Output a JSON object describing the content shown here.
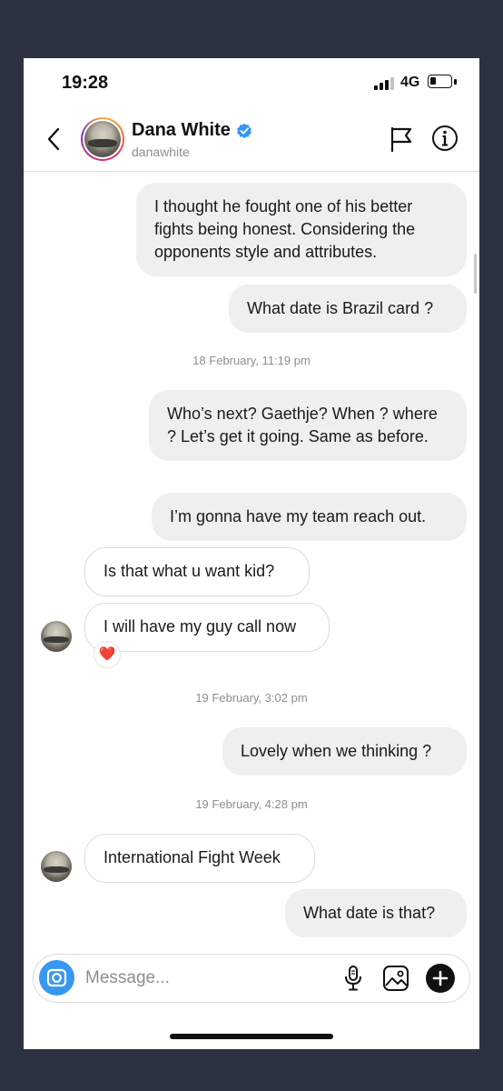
{
  "status_bar": {
    "time": "19:28",
    "network": "4G",
    "signal_bars": 3,
    "battery_level": 0.2
  },
  "header": {
    "name": "Dana White",
    "handle": "danawhite",
    "verified": true,
    "icons": [
      "back-arrow-icon",
      "verified-badge-icon",
      "flag-icon",
      "info-icon"
    ]
  },
  "messages": [
    {
      "from": "me",
      "text": "I thought he fought one of his better fights being honest. Considering the opponents style and attributes."
    },
    {
      "from": "me",
      "text": "What date is Brazil card ?"
    },
    {
      "type": "timestamp",
      "text": "18 February, 11:19 pm"
    },
    {
      "from": "me",
      "text": "Who’s next? Gaethje? When ? where ? Let’s get it going. Same as before."
    },
    {
      "from": "me",
      "text": "I’m gonna have my team reach out."
    },
    {
      "from": "them",
      "text": "Is that what u want kid?"
    },
    {
      "from": "them",
      "text": "I will have my guy call now",
      "reaction": "❤️"
    },
    {
      "type": "timestamp",
      "text": "19 February, 3:02 pm"
    },
    {
      "from": "me",
      "text": "Lovely when we thinking ?"
    },
    {
      "type": "timestamp",
      "text": "19 February, 4:28 pm"
    },
    {
      "from": "them",
      "text": "International Fight Week"
    },
    {
      "from": "me",
      "text": "What date is that?"
    }
  ],
  "composer": {
    "placeholder": "Message...",
    "icons": [
      "camera-icon",
      "microphone-icon",
      "gallery-icon",
      "plus-icon"
    ]
  },
  "colors": {
    "camera_button": "#3897f0",
    "verified": "#3897f0",
    "outgoing_bubble": "#efefef",
    "heart": "#e0303d"
  }
}
